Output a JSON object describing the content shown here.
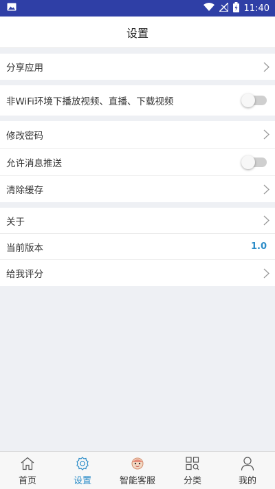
{
  "status_bar": {
    "time": "11:40"
  },
  "header": {
    "title": "设置"
  },
  "groups": [
    {
      "rows": [
        {
          "label": "分享应用",
          "control": "chevron"
        }
      ]
    },
    {
      "rows": [
        {
          "label": "非WiFi环境下播放视频、直播、下载视频",
          "control": "toggle",
          "on": false
        }
      ]
    },
    {
      "rows": [
        {
          "label": "修改密码",
          "control": "chevron"
        },
        {
          "label": "允许消息推送",
          "control": "toggle",
          "on": false
        },
        {
          "label": "清除缓存",
          "control": "chevron"
        }
      ]
    },
    {
      "rows": [
        {
          "label": "关于",
          "control": "chevron"
        },
        {
          "label": "当前版本",
          "control": "value",
          "value": "1.0"
        },
        {
          "label": "给我评分",
          "control": "chevron"
        }
      ]
    }
  ],
  "tabbar": {
    "items": [
      {
        "label": "首页",
        "icon": "home-icon",
        "active": false
      },
      {
        "label": "设置",
        "icon": "settings-icon",
        "active": true
      },
      {
        "label": "智能客服",
        "icon": "robot-avatar-icon",
        "active": false
      },
      {
        "label": "分类",
        "icon": "category-grid-icon",
        "active": false
      },
      {
        "label": "我的",
        "icon": "user-icon",
        "active": false
      }
    ]
  },
  "colors": {
    "status_bar": "#2f3fa6",
    "accent": "#2b8cc8",
    "background": "#eef0f4"
  }
}
